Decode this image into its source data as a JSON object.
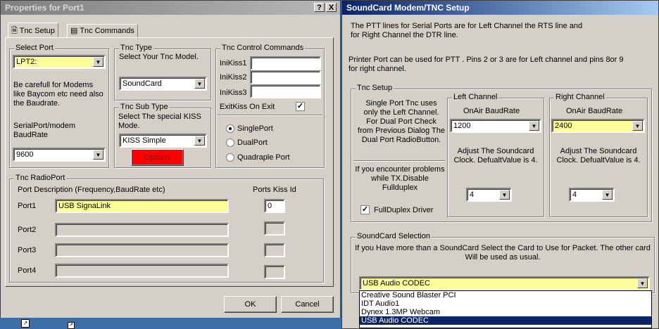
{
  "left_window": {
    "title": "Properties for Port1",
    "help_button": "?",
    "close_button": "X",
    "tabs": [
      "Tnc Setup",
      "Tnc Commands"
    ],
    "select_port": {
      "group_title": "Select Port",
      "value": "LPT2:",
      "note": "Be carefull for Modems like Baycom etc need also the Baudrate.",
      "baud_label": "SerialPort/modem BaudRate",
      "baud_value": "9600"
    },
    "tnc_type": {
      "group_title": "Tnc Type",
      "prompt": "Select Your Tnc Model.",
      "value": "SoundCard"
    },
    "tnc_sub_type": {
      "group_title": "Tnc Sub Type",
      "prompt": "Select The special KISS Mode.",
      "value": "KISS Simple",
      "options_button": "Options"
    },
    "tnc_control": {
      "group_title": "Tnc Control Commands",
      "labels": [
        "IniKiss1",
        "IniKiss2",
        "IniKiss3"
      ],
      "exit_label": "ExitKiss On Exit",
      "exit_checked": true,
      "radios": [
        "SinglePort",
        "DualPort",
        "Quadraple Port"
      ],
      "selected_radio": 0
    },
    "radioport": {
      "group_title": "Tnc RadioPort",
      "desc_header": "Port Description (Frequency,BaudRate etc)",
      "kiss_header": "Ports Kiss Id",
      "ports": [
        {
          "label": "Port1",
          "desc": "USB SignaLink",
          "kiss": "0"
        },
        {
          "label": "Port2",
          "desc": "",
          "kiss": ""
        },
        {
          "label": "Port3",
          "desc": "",
          "kiss": ""
        },
        {
          "label": "Port4",
          "desc": "",
          "kiss": ""
        }
      ]
    },
    "ok_button": "OK",
    "cancel_button": "Cancel"
  },
  "right_window": {
    "title": "SoundCard Modem/TNC Setup",
    "info1": "The PTT lines for Serial Ports are for Left Channel the RTS line and for Right Channel the DTR line.",
    "info2": "Printer Port can be used for PTT . Pins 2 or 3 are for Left channel and pins 8or 9 for right channel.",
    "tnc_setup": {
      "group_title": "Tnc Setup",
      "single_note": "Single Port Tnc uses only the Left Channel. For Dual Port Check from Previous Dialog The Dual Port RadioButton.",
      "problem_note": "If you encounter problems while TX.Disable Fullduplex",
      "fullduplex_label": "FullDuplex Driver",
      "fullduplex_checked": true,
      "left": {
        "group_title": "Left Channel",
        "baud_label": "OnAir BaudRate",
        "baud_value": "1200",
        "adjust_note": "Adjust The Soundcard Clock. DefualtValue is 4.",
        "clock_value": "4"
      },
      "right": {
        "group_title": "Right Channel",
        "baud_label": "OnAir BaudRate",
        "baud_value": "2400",
        "adjust_note": "Adjust The Soundcard Clock. DefualtValue is 4.",
        "clock_value": "4"
      }
    },
    "soundcard_selection": {
      "group_title": "SoundCard Selection",
      "note": "If you Have more than a SoundCard Select the Card to Use for Packet. The other card Will be used as usual.",
      "selected": "USB Audio CODEC",
      "options": [
        "Creative Sound Blaster PCI",
        "IDT Audio1",
        "Dynex 1.3MP Webcam",
        "USB Audio CODEC"
      ],
      "selected_index": 3
    }
  },
  "colors": {
    "dialog_face": "#d4d0c8",
    "active_title": "#0a246a",
    "field_yellow": "#ffff99",
    "options_button_red": "#ff0000",
    "desktop": "#3a6ea5"
  }
}
